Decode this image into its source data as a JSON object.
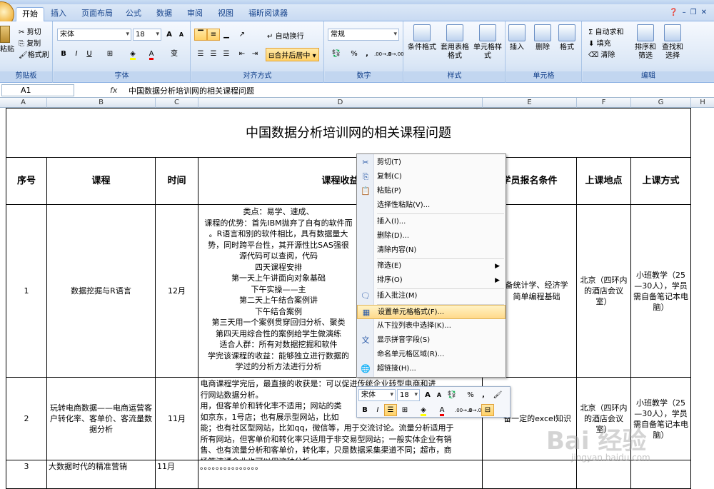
{
  "tabs": [
    "开始",
    "插入",
    "页面布局",
    "公式",
    "数据",
    "审阅",
    "视图",
    "福昕阅读器"
  ],
  "ribbon": {
    "clipboard": {
      "label": "剪贴板",
      "paste": "粘贴",
      "cut": "剪切",
      "copy": "复制",
      "painter": "格式刷"
    },
    "font": {
      "label": "字体",
      "name": "宋体",
      "size": "18",
      "grow": "A",
      "shrink": "A",
      "bold": "B",
      "italic": "I",
      "underline": "U",
      "wen": "变"
    },
    "align": {
      "label": "对齐方式",
      "wrap": "自动换行",
      "merge": "合并后居中"
    },
    "number": {
      "label": "数字",
      "format": "常规",
      "percent": "%",
      "comma": ",",
      "incdec": ".00→.0",
      "decdec": ".0→.00"
    },
    "styles": {
      "label": "样式",
      "cond": "条件格式",
      "table": "套用表格格式",
      "cell": "单元格样式"
    },
    "cells": {
      "label": "单元格",
      "insert": "插入",
      "delete": "删除",
      "format": "格式"
    },
    "edit": {
      "label": "编辑",
      "sum": "自动求和",
      "fill": "填充",
      "clear": "清除",
      "sort": "排序和筛选",
      "find": "查找和选择"
    }
  },
  "formula": {
    "name": "A1",
    "fx": "fx",
    "content": "中国数据分析培训网的相关课程问题"
  },
  "cols": [
    "A",
    "B",
    "C",
    "D",
    "E",
    "F",
    "G",
    "H"
  ],
  "sheet": {
    "title": "中国数据分析培训网的相关课程问题",
    "headers": [
      "序号",
      "课程",
      "时间",
      "课程收益",
      "学员报名条件",
      "上课地点",
      "上课方式"
    ],
    "r1": {
      "no": "1",
      "course": "数据挖掘与R语言",
      "time": "12月",
      "benefit": [
        "类点：易学、速成、",
        "课程的优势：首先IBM抛弃了自有的软件而",
        "。R语言和别的软件相比，具有数据量大",
        "势，同时跨平台性，其开源性比SAS强很",
        "源代码可以查阅，代码",
        "四天课程安排",
        "第一天上午讲面向对象基础",
        "下午实操——主",
        "第二天上午结合案例讲",
        "下午结合案例",
        "第三天用一个案例贯穿回归分析、聚类",
        "第四天用综合性的案例给学生做演练",
        "适合人群：所有对数据挖掘和软件",
        "学完该课程的收益：能够独立进行数据的",
        "学过的分析方法进行分析"
      ],
      "cond": [
        "备统计学、经济学",
        "简单编程基础"
      ],
      "place": "北京（四环内的酒店会议室）",
      "mode": "小班教学（25—30人），学员需自备笔记本电脑）"
    },
    "r2": {
      "no": "2",
      "course": "玩转电商数据——电商运营客户转化率、客单价、客流量数据分析",
      "time": "11月",
      "benefit": [
        "电商课程学完后，最直接的收获是：可以促进传统企业转型电商和进",
        "行网站数据分析。",
        "用，但客单价和转化率不适用；网站的类",
        "如京东，1号店；也有展示型网站，比如",
        "能；也有社区型网站，比如qq，微信等，用于交流讨论。流量分析适用于",
        "所有网站，但客单价和转化率只适用于非交易型网站；一般实体企业有销",
        "售、也有流量分析和客单价，转化率，只是数据采集渠道不同；超市，商",
        "场等流通企业也可以用这种分析。"
      ],
      "cond": "备一定的excel知识",
      "place": "北京（四环内的酒店会议室）",
      "mode": "小班教学（25—30人），学员需自备笔记本电脑）"
    },
    "r3": {
      "no": "3",
      "course": "大数据时代的精准营销",
      "time": "11月",
      "benefit": "。。。。。。。。。。。。。。。"
    }
  },
  "ctxmenu": [
    "剪切(T)",
    "复制(C)",
    "粘贴(P)",
    "选择性粘贴(V)...",
    "插入(I)...",
    "删除(D)...",
    "清除内容(N)",
    "筛选(E)",
    "排序(O)",
    "插入批注(M)",
    "设置单元格格式(F)...",
    "从下拉列表中选择(K)...",
    "显示拼音字段(S)",
    "命名单元格区域(R)...",
    "超链接(H)..."
  ],
  "mini": {
    "font": "宋体",
    "size": "18"
  },
  "watermark": {
    "text": "Bai 经验",
    "url": "jingyan.baidu.com"
  }
}
